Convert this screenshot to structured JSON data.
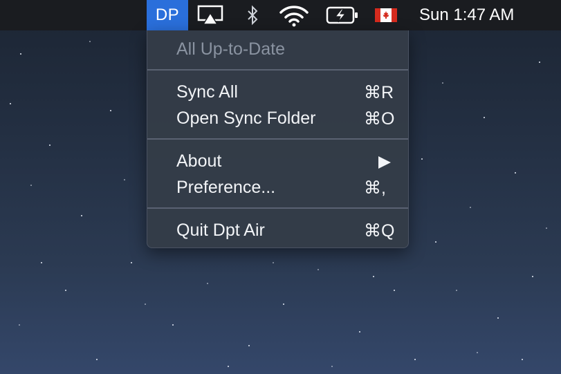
{
  "menubar": {
    "app_badge": "DP",
    "icons": [
      "airplay-icon",
      "bluetooth-icon",
      "wifi-icon",
      "battery-charging-icon",
      "canada-flag-icon"
    ],
    "clock": "Sun 1:47 AM",
    "colors": {
      "bar_background": "#1a1c20",
      "badge_background": "#2a6fdb",
      "flag_red": "#d52b1e"
    }
  },
  "menu": {
    "status": "All Up-to-Date",
    "sync_all": {
      "label": "Sync All",
      "shortcut": "⌘R"
    },
    "open_sync_folder": {
      "label": "Open Sync Folder",
      "shortcut": "⌘O"
    },
    "about": {
      "label": "About",
      "submenu_icon": "submenu-arrow-icon"
    },
    "preference": {
      "label": "Preference...",
      "shortcut": "⌘,"
    },
    "quit": {
      "label": "Quit Dpt Air",
      "shortcut": "⌘Q"
    }
  }
}
